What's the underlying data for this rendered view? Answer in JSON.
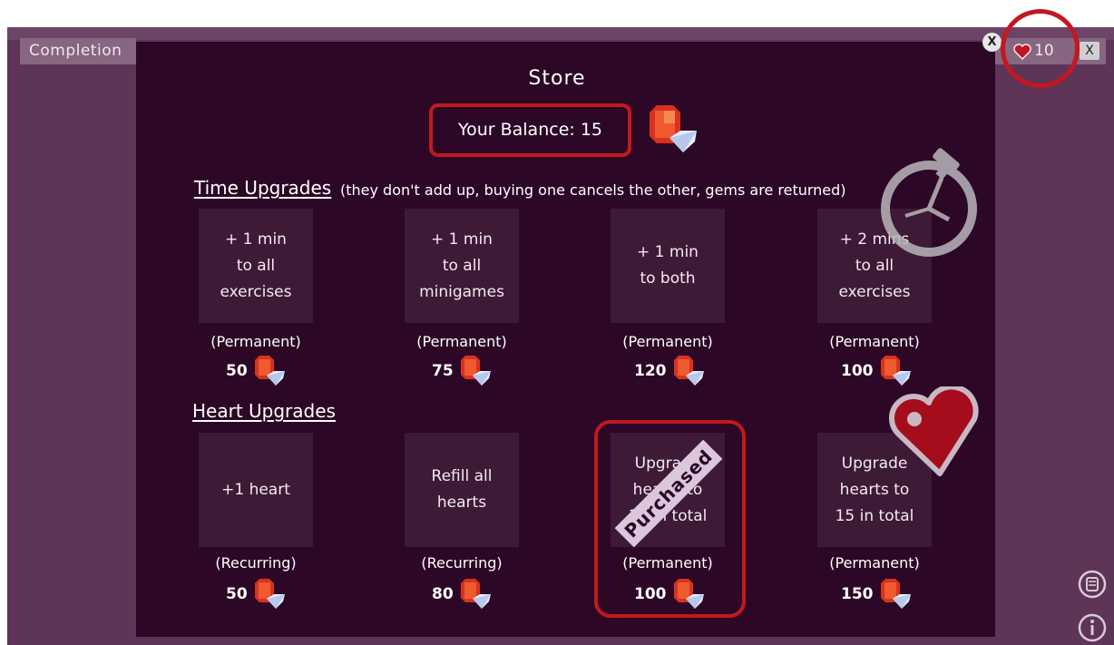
{
  "app": {
    "completion_label": "Completion",
    "hearts_count": "10",
    "close_label": "X",
    "store_close_label": "X"
  },
  "store": {
    "title": "Store",
    "balance": "Your Balance: 15"
  },
  "time_upgrades": {
    "heading": "Time Upgrades",
    "note": "(they don't add up, buying one cancels the other, gems are returned)",
    "items": [
      {
        "label": "+ 1 min\nto all\nexercises",
        "type": "(Permanent)",
        "price": "50"
      },
      {
        "label": "+ 1 min\nto all\nminigames",
        "type": "(Permanent)",
        "price": "75"
      },
      {
        "label": "+ 1 min\nto both",
        "type": "(Permanent)",
        "price": "120"
      },
      {
        "label": "+ 2 mins\nto all\nexercises",
        "type": "(Permanent)",
        "price": "100"
      }
    ]
  },
  "heart_upgrades": {
    "heading": "Heart Upgrades",
    "items": [
      {
        "label": "+1 heart",
        "type": "(Recurring)",
        "price": "50"
      },
      {
        "label": "Refill all\nhearts",
        "type": "(Recurring)",
        "price": "80"
      },
      {
        "label": "Upgrade\nhearts to\n10 in total",
        "type": "(Permanent)",
        "price": "100",
        "badge": "Purchased"
      },
      {
        "label": "Upgrade\nhearts to\n15 in total",
        "type": "(Permanent)",
        "price": "150"
      }
    ]
  },
  "colors": {
    "modal_bg": "#2c0826",
    "card_bg": "#3d1a36",
    "highlight": "#c01a1e",
    "app_bg": "#5e3457"
  },
  "icons": [
    "gem-icon",
    "heart-icon",
    "stopwatch-icon",
    "scroll-icon",
    "info-icon"
  ]
}
